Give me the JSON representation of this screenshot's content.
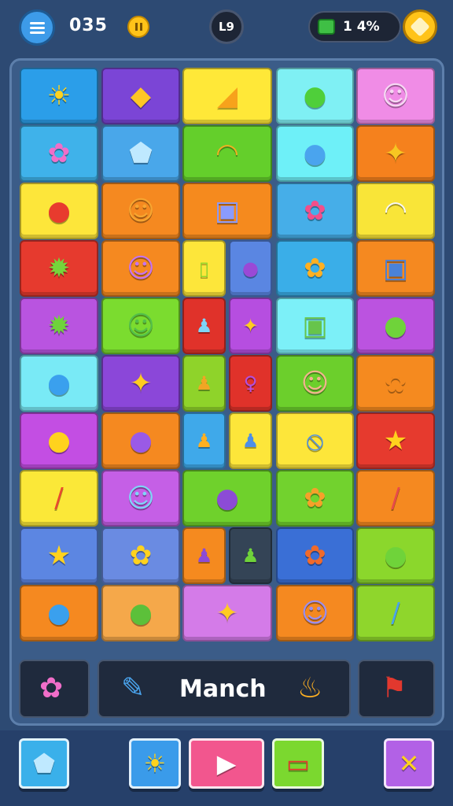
{
  "header": {
    "score": "035",
    "level": "L9",
    "progress": "1 4%"
  },
  "board": {
    "rows": [
      [
        {
          "bg": "#2b9ee9",
          "sym": "☀",
          "c": "#ffd21e"
        },
        {
          "bg": "#7b45d6",
          "sym": "◆",
          "c": "#ffc624"
        },
        {
          "bg": "#ffe838",
          "sym": "◢",
          "c": "#f7a21b"
        },
        {
          "bg": "#7ff0f4",
          "sym": "●",
          "c": "#4fcf3a"
        },
        {
          "bg": "#f08ce6",
          "sym": "☺",
          "c": "#f6d9f3"
        }
      ],
      [
        {
          "bg": "#3fb2ea",
          "sym": "✿",
          "c": "#f06ec9"
        },
        {
          "bg": "#49a7ea",
          "sym": "⬟",
          "c": "#bfe9ff"
        },
        {
          "bg": "#64cf2b",
          "sym": "◠",
          "c": "#f1b021"
        },
        {
          "bg": "#6ef0f8",
          "sym": "●",
          "c": "#4aa4ee"
        },
        {
          "bg": "#f5811d",
          "sym": "✦",
          "c": "#f7c622"
        }
      ],
      [
        {
          "bg": "#fde63a",
          "sym": "●",
          "c": "#e83b2e"
        },
        {
          "bg": "#f58920",
          "sym": "☺",
          "c": "#f7a530"
        },
        {
          "bg": "#f58a1e",
          "sym": "▣",
          "c": "#8a9bff"
        },
        {
          "bg": "#46aee8",
          "sym": "✿",
          "c": "#f24f8a"
        },
        {
          "bg": "#f9e538",
          "sym": "◠",
          "c": "#f7f7f7"
        }
      ],
      [
        {
          "bg": "#e63a2e",
          "sym": "✹",
          "c": "#75d63b"
        },
        {
          "bg": "#f58920",
          "sym": "☺",
          "c": "#c673f0"
        },
        {
          "bg": "#5cc0f1",
          "sym": "◍",
          "c": "#f6a4e6"
        },
        {
          "bg": "#3aaee8",
          "sym": "✿",
          "c": "#ffb022"
        },
        {
          "bg": "#f58920",
          "sym": "▣",
          "c": "#4a82d8"
        }
      ],
      [
        {
          "bg": "#b954e0",
          "sym": "✹",
          "c": "#6fd33a"
        },
        {
          "bg": "#7bdc2f",
          "sym": "☺",
          "c": "#53c04a"
        },
        {
          "bg": "#d93a2f",
          "sym": "♟",
          "c": "#68b8f2"
        },
        {
          "bg": "#7cf0f8",
          "sym": "▣",
          "c": "#67c44b"
        },
        {
          "bg": "#bb53e0",
          "sym": "●",
          "c": "#6fd33a"
        }
      ],
      [
        {
          "bg": "#79eaf6",
          "sym": "●",
          "c": "#3aa0ee"
        },
        {
          "bg": "#8b47d9",
          "sym": "✦",
          "c": "#ffcc20"
        },
        {
          "bg": "#8fd32a",
          "sym": "♟",
          "c": "#f1a624"
        },
        {
          "bg": "#6ccf2c",
          "sym": "☺",
          "c": "#f2b48f"
        },
        {
          "bg": "#f58a1f",
          "sym": "✿",
          "c": "#f58a1f"
        }
      ],
      [
        {
          "bg": "#c34ee3",
          "sym": "●",
          "c": "#ffd21e"
        },
        {
          "bg": "#f58920",
          "sym": "●",
          "c": "#9a5ae6"
        },
        {
          "bg": "#3fa9ea",
          "sym": "♟",
          "c": "#ffb022"
        },
        {
          "bg": "#fde63a",
          "sym": "⦸",
          "c": "#4d8fe7"
        },
        {
          "bg": "#e63a2e",
          "sym": "★",
          "c": "#ffd21e"
        }
      ],
      [
        {
          "bg": "#fbe838",
          "sym": "/",
          "c": "#e84a2e"
        },
        {
          "bg": "#c55fe6",
          "sym": "☺",
          "c": "#7fd5f7"
        },
        {
          "bg": "#6fd12c",
          "sym": "●",
          "c": "#8c4bd6"
        },
        {
          "bg": "#72d22e",
          "sym": "✿",
          "c": "#f6a02a"
        },
        {
          "bg": "#f58920",
          "sym": "/",
          "c": "#e84a4a"
        }
      ],
      [
        {
          "bg": "#5c86e2",
          "sym": "★",
          "c": "#ffd21e"
        },
        {
          "bg": "#6a8be2",
          "sym": "✿",
          "c": "#ffd21e"
        },
        {
          "bg": "#f58a1f",
          "sym": "♟",
          "c": "#8c4bd6"
        },
        {
          "bg": "#3a6fd6",
          "sym": "✿",
          "c": "#f06a2a"
        },
        {
          "bg": "#8bd72c",
          "sym": "●",
          "c": "#6fd33a"
        }
      ],
      [
        {
          "bg": "#f58920",
          "sym": "●",
          "c": "#3aa0ee"
        },
        {
          "bg": "#f5a84a",
          "sym": "●",
          "c": "#5cc03a"
        },
        {
          "bg": "#d47be8",
          "sym": "✦",
          "c": "#ffcc20"
        },
        {
          "bg": "#f58920",
          "sym": "☺",
          "c": "#9a8ef0"
        },
        {
          "bg": "#8fd62c",
          "sym": "/",
          "c": "#4aa4ee"
        }
      ]
    ],
    "splits": {
      "3-2": [
        {
          "bg": "#fde63a",
          "sym": "▯",
          "c": "#8fd62c"
        },
        {
          "bg": "#5a86e2",
          "sym": "●",
          "c": "#9a49d6"
        }
      ],
      "4-2": [
        {
          "bg": "#e0322a",
          "sym": "♟",
          "c": "#7fd5f7"
        },
        {
          "bg": "#b64ee0",
          "sym": "✦",
          "c": "#ffcc20"
        }
      ],
      "5-2": [
        {
          "bg": "#8fd32a",
          "sym": "♟",
          "c": "#f1a624"
        },
        {
          "bg": "#e0322a",
          "sym": "♀",
          "c": "#b44fe0"
        }
      ],
      "6-2": [
        {
          "bg": "#3fa9ea",
          "sym": "♟",
          "c": "#ffb022"
        },
        {
          "bg": "#fde63a",
          "sym": "♟",
          "c": "#4d8fe7"
        }
      ],
      "8-2": [
        {
          "bg": "#f58a1f",
          "sym": "♟",
          "c": "#8c4bd6"
        },
        {
          "bg": "#344456",
          "sym": "♟",
          "c": "#6fd33a"
        }
      ]
    }
  },
  "action_bar": {
    "left_icon": "pink-flower-icon",
    "main_label": "Manch",
    "right_icon": "flag-card-icon"
  },
  "bottom_bar": {
    "buttons": [
      {
        "name": "ghost-button",
        "bg": "#3ab0ea",
        "sym": "⬟",
        "c": "#bfe9ff"
      },
      {
        "name": "sun-button",
        "bg": "#3a9bea",
        "sym": "☀",
        "c": "#ffd21e"
      },
      {
        "name": "play-button",
        "bg": "#f2568e",
        "sym": "▶",
        "c": "#ffffff"
      },
      {
        "name": "card-button",
        "bg": "#7bd82f",
        "sym": "▭",
        "c": "#e2382e"
      },
      {
        "name": "close-button",
        "bg": "#b261e6",
        "sym": "✕",
        "c": "#ffd21e"
      }
    ]
  }
}
